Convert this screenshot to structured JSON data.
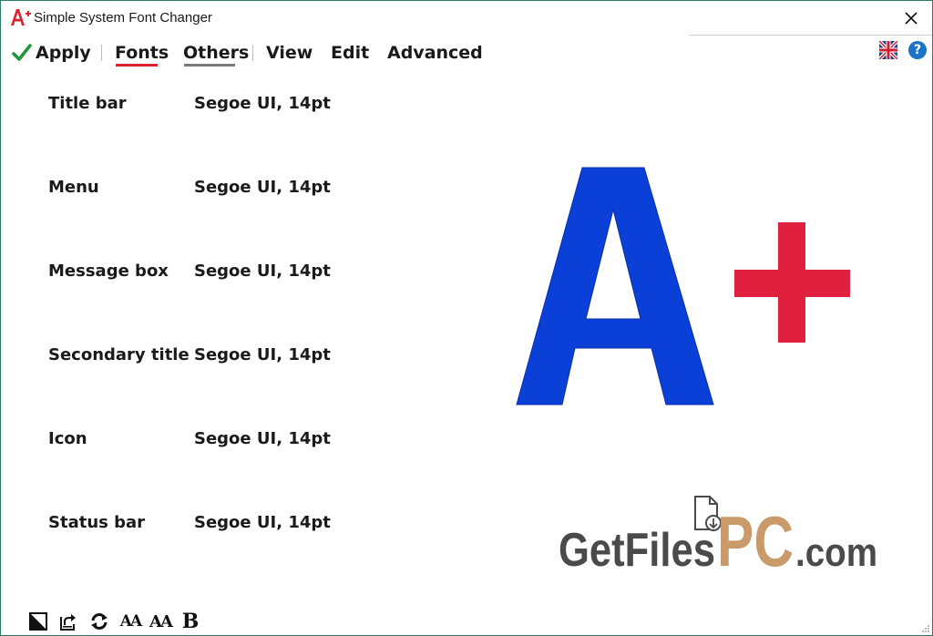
{
  "window": {
    "title": "Simple System Font Changer"
  },
  "menu": {
    "apply": "Apply",
    "fonts": "Fonts",
    "others": "Others",
    "view": "View",
    "edit": "Edit",
    "advanced": "Advanced"
  },
  "rows": [
    {
      "label": "Title bar",
      "value": "Segoe UI, 14pt"
    },
    {
      "label": "Menu",
      "value": "Segoe UI, 14pt"
    },
    {
      "label": "Message box",
      "value": "Segoe UI, 14pt"
    },
    {
      "label": "Secondary title",
      "value": "Segoe UI, 14pt"
    },
    {
      "label": "Icon",
      "value": "Segoe UI, 14pt"
    },
    {
      "label": "Status bar",
      "value": "Segoe UI, 14pt"
    }
  ],
  "toolbar": {
    "small_font": "AA",
    "large_font": "AA",
    "bold": "B"
  },
  "help": {
    "glyph": "?"
  },
  "watermark": {
    "part1": "GetFiles",
    "part2": "PC",
    "part3": ".com"
  },
  "colors": {
    "accent_red": "#d9232e",
    "logo_blue": "#0a3fd8",
    "logo_red": "#e0203f",
    "watermark_gray": "#4a4a4a",
    "watermark_tan": "#c99a6a"
  },
  "icons": {
    "app": "app-logo-icon",
    "close": "close-icon",
    "apply": "checkmark-icon",
    "language": "uk-flag-icon",
    "help": "help-icon",
    "contrast": "contrast-icon",
    "export": "export-icon",
    "refresh": "refresh-icon"
  }
}
